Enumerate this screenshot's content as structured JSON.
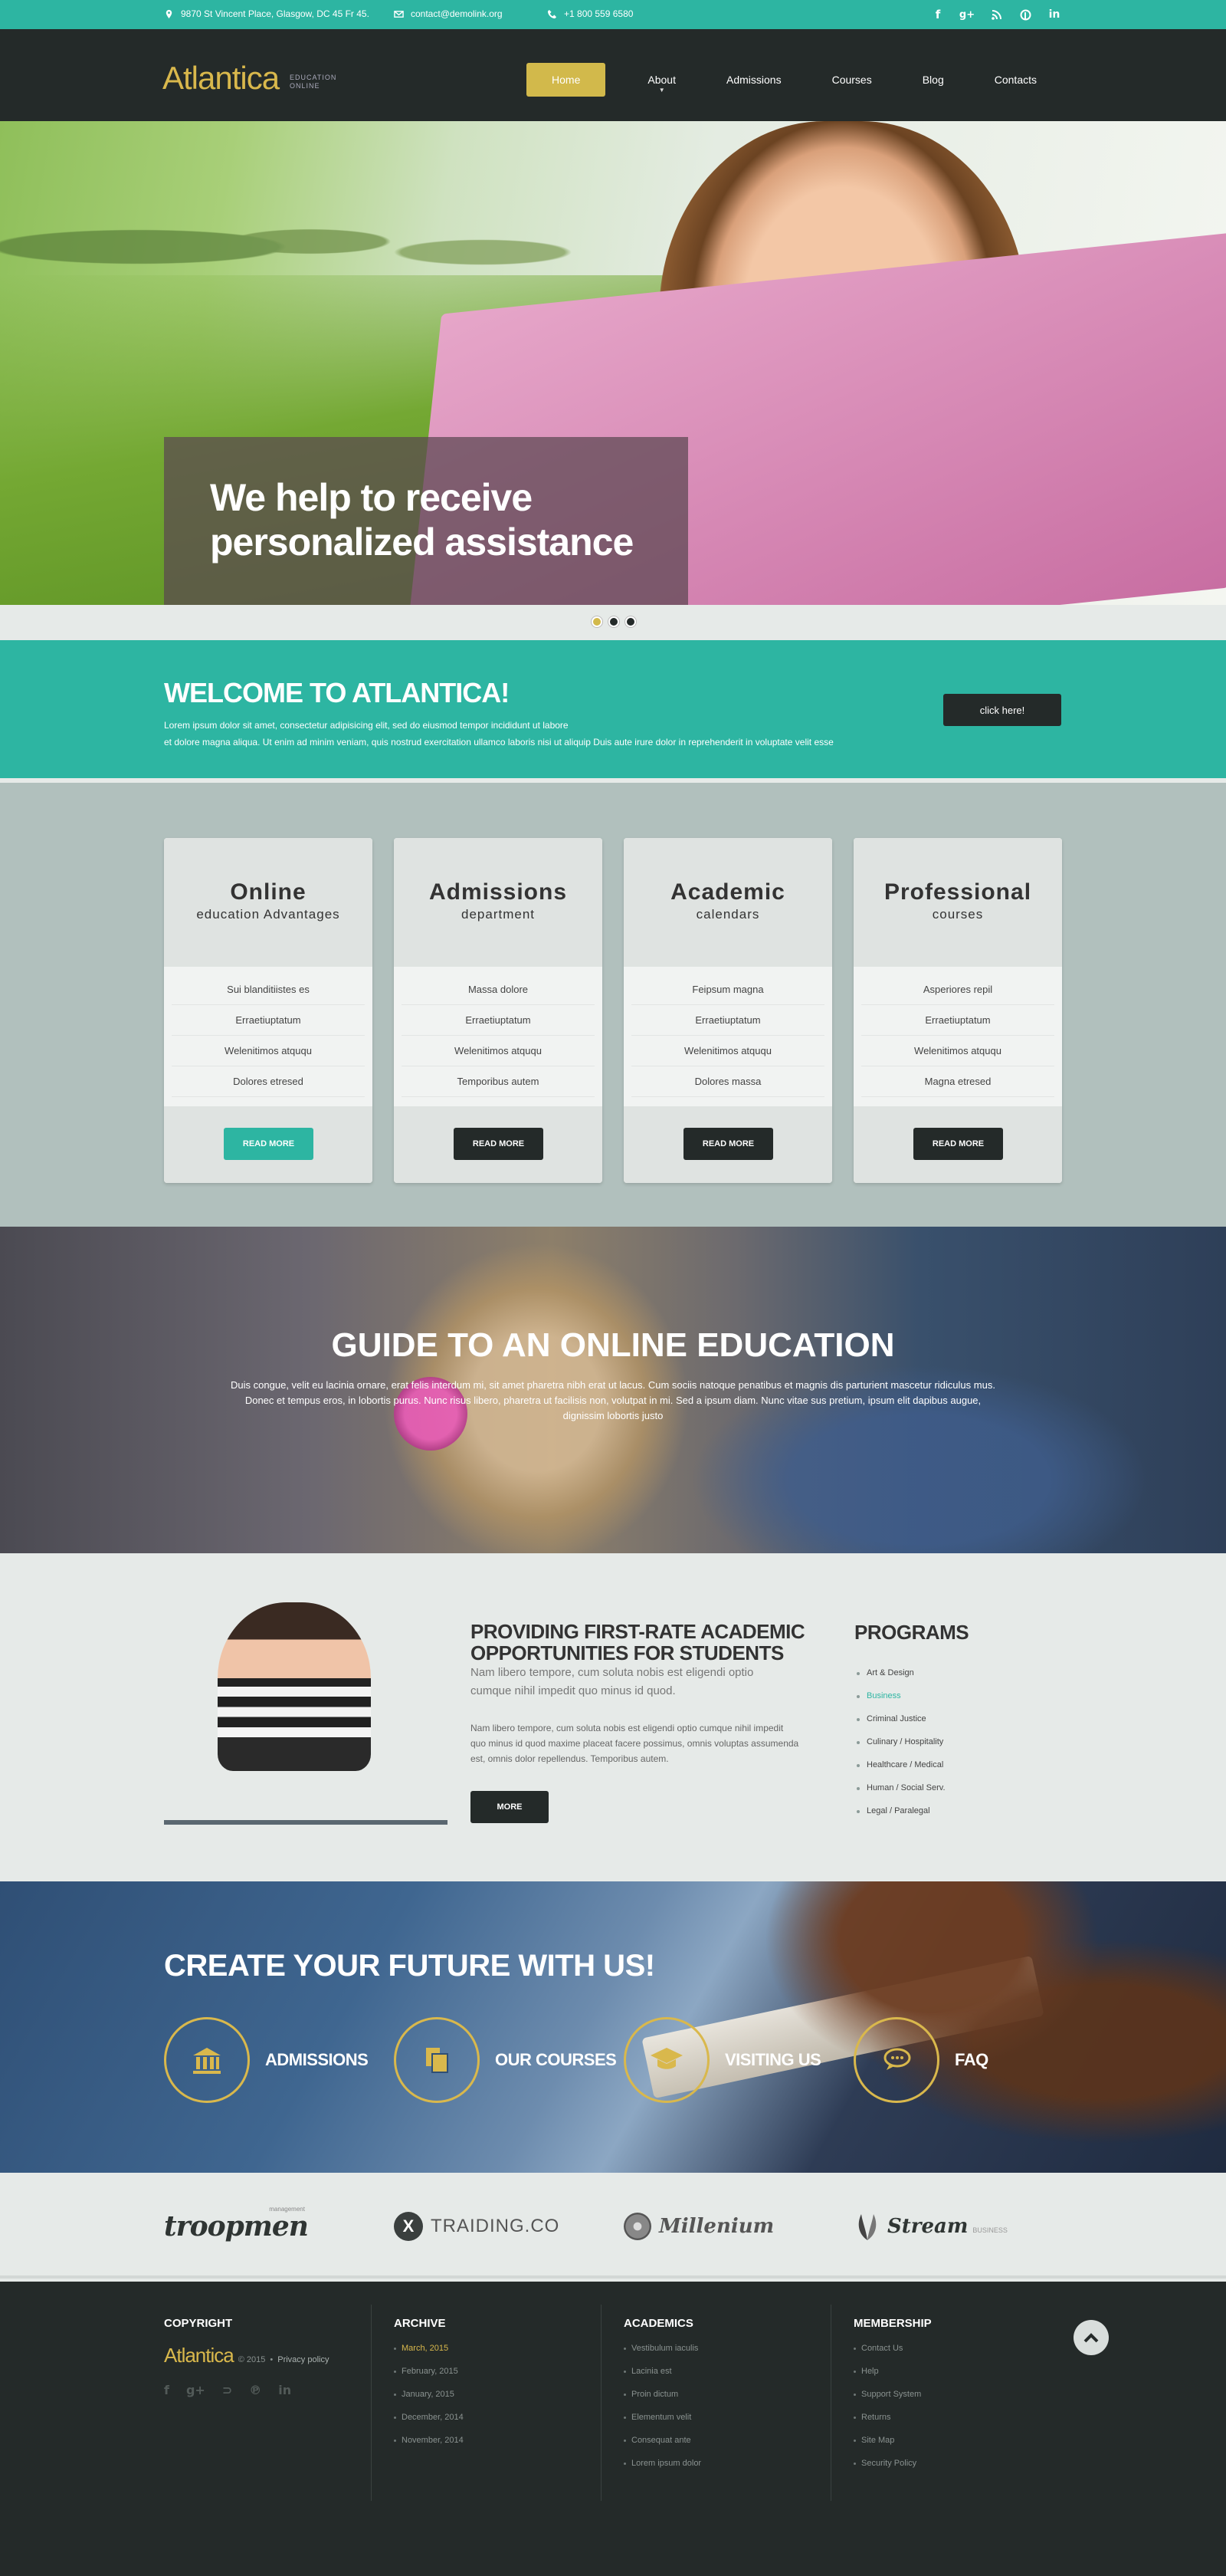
{
  "topbar": {
    "address": "9870 St Vincent Place, Glasgow, DC 45 Fr 45.",
    "email": "contact@demolink.org",
    "phone": "+1 800 559 6580",
    "social": [
      "f",
      "g+",
      "rss",
      "p",
      "in"
    ]
  },
  "header": {
    "logo": "Atlantica",
    "tagline_1": "EDUCATION",
    "tagline_2": "ONLINE",
    "nav": [
      "Home",
      "About",
      "Admissions",
      "Courses",
      "Blog",
      "Contacts"
    ],
    "active": "Home",
    "accent": "#d2b94b"
  },
  "hero": {
    "caption_1": "We help to receive",
    "caption_2": "personalized assistance",
    "slides": 3,
    "active_slide": 1
  },
  "welcome": {
    "title": "WELCOME TO ATLANTICA!",
    "text_1": "Lorem ipsum dolor sit amet, consectetur adipisicing elit, sed do eiusmod tempor incididunt ut labore",
    "text_2": "et dolore magna aliqua. Ut enim ad minim veniam, quis nostrud exercitation ullamco laboris nisi ut aliquip Duis aute irure dolor in reprehenderit in voluptate velit esse",
    "button": "click here!",
    "color": "#2db5a2"
  },
  "cards": [
    {
      "title": "Online",
      "subtitle": "education Advantages",
      "items": [
        "Sui blanditiistes es",
        "Erraetiuptatum",
        "Welenitimos atququ",
        "Dolores etresed"
      ],
      "button": "READ MORE",
      "highlight": true
    },
    {
      "title": "Admissions",
      "subtitle": "department",
      "items": [
        "Massa dolore",
        "Erraetiuptatum",
        "Welenitimos atququ",
        "Temporibus autem"
      ],
      "button": "READ MORE",
      "highlight": false
    },
    {
      "title": "Academic",
      "subtitle": "calendars",
      "items": [
        "Feipsum magna",
        "Erraetiuptatum",
        "Welenitimos atququ",
        "Dolores massa"
      ],
      "button": "READ MORE",
      "highlight": false
    },
    {
      "title": "Professional",
      "subtitle": "courses",
      "items": [
        "Asperiores repil",
        "Erraetiuptatum",
        "Welenitimos atququ",
        "Magna etresed"
      ],
      "button": "READ MORE",
      "highlight": false
    }
  ],
  "guide": {
    "title": "GUIDE TO AN ONLINE EDUCATION",
    "text_1": "Duis congue, velit eu lacinia ornare, erat felis interdum mi, sit amet pharetra nibh erat ut lacus. Cum sociis natoque penatibus et magnis dis parturient mascetur",
    "text_2": "ridiculus mus. Donec et tempus eros, in lobortis purus. Nunc risus libero, pharetra ut facilisis non, volutpat in mi. Sed a ipsum diam. Nunc vitae sus",
    "text_3": "pretium, ipsum elit dapibus augue, dignissim lobortis justo"
  },
  "provide": {
    "title": "PROVIDING FIRST-RATE ACADEMIC OPPORTUNITIES FOR STUDENTS",
    "lead": "Nam libero tempore, cum soluta nobis est eligendi optio cumque nihil impedit quo minus id quod.",
    "body": "Nam libero tempore, cum soluta nobis est eligendi optio cumque nihil impedit quo minus id quod maxime placeat facere possimus, omnis voluptas assumenda est, omnis dolor repellendus. Temporibus autem.",
    "button": "MORE",
    "programs_title": "PROGRAMS",
    "programs": [
      "Art & Design",
      "Business",
      "Criminal Justice",
      "Culinary / Hospitality",
      "Healthcare / Medical",
      "Human / Social Serv.",
      "Legal / Paralegal"
    ],
    "highlight": "Business"
  },
  "create": {
    "title": "CREATE YOUR FUTURE WITH US!",
    "items": [
      {
        "label": "ADMISSIONS",
        "icon": "building-icon"
      },
      {
        "label": "OUR COURSES",
        "icon": "document-icon"
      },
      {
        "label": "VISITING US",
        "icon": "graduation-cap-icon"
      },
      {
        "label": "FAQ",
        "icon": "chat-icon"
      }
    ]
  },
  "logos": {
    "troopmen": "troopmen",
    "troopmen_small": "management",
    "traiding": "TRAIDING.CO",
    "millenium": "Millenium",
    "stream": "Stream",
    "stream_small": "BUSINESS"
  },
  "footer": {
    "copyright_title": "COPYRIGHT",
    "logo": "Atlantica",
    "year": "© 2015",
    "privacy": "Privacy policy",
    "archive_title": "ARCHIVE",
    "archive": [
      "March, 2015",
      "February, 2015",
      "January, 2015",
      "December, 2014",
      "November, 2014"
    ],
    "academics_title": "ACADEMICS",
    "academics": [
      "Vestibulum iaculis",
      "Lacinia est",
      "Proin dictum",
      "Elementum velit",
      "Consequat ante",
      "Lorem ipsum dolor"
    ],
    "membership_title": "MEMBERSHIP",
    "membership": [
      "Contact Us",
      "Help",
      "Support System",
      "Returns",
      "Site Map",
      "Security Policy"
    ]
  }
}
